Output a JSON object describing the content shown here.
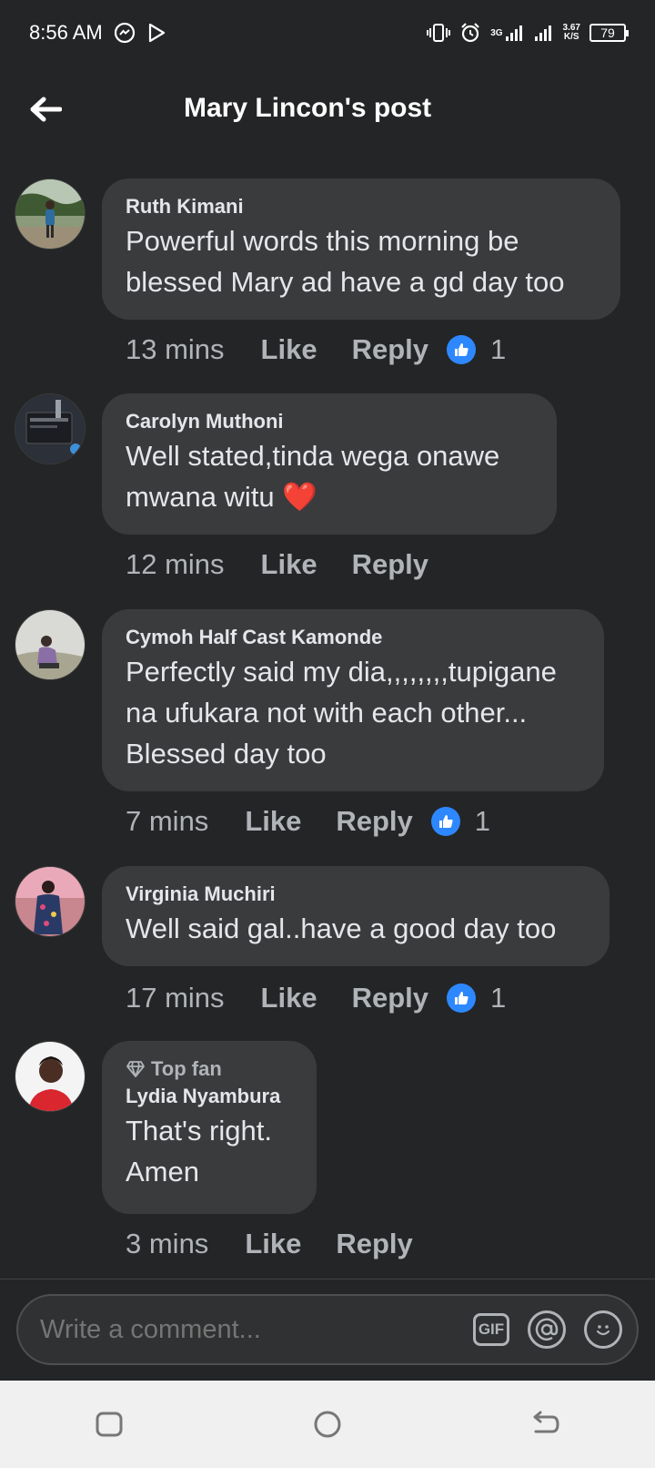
{
  "status_bar": {
    "time": "8:56 AM",
    "network_type": "3G",
    "net_speed_value": "3.67",
    "net_speed_unit": "K/S",
    "battery": "79"
  },
  "header": {
    "title": "Mary Lincon's post"
  },
  "comments": [
    {
      "author": "Ruth Kimani",
      "lines": [
        "Powerful words this morning be",
        "blessed Mary ad have a gd day too"
      ],
      "time": "13 mins",
      "like_label": "Like",
      "reply_label": "Reply",
      "reaction_count": "1"
    },
    {
      "author": "Carolyn Muthoni",
      "lines": [
        "Well stated,tinda wega onawe",
        "mwana witu ❤️"
      ],
      "time": "12 mins",
      "like_label": "Like",
      "reply_label": "Reply"
    },
    {
      "author": "Cymoh Half Cast Kamonde",
      "lines": [
        "Perfectly said my dia,,,,,,,,tupigane",
        "na ufukara not with each other...",
        "Blessed day too"
      ],
      "time": "7 mins",
      "like_label": "Like",
      "reply_label": "Reply",
      "reaction_count": "1"
    },
    {
      "author": "Virginia Muchiri",
      "lines": [
        "Well said gal..have a good day too"
      ],
      "time": "17 mins",
      "like_label": "Like",
      "reply_label": "Reply",
      "reaction_count": "1"
    },
    {
      "badge": "Top fan",
      "author": "Lydia Nyambura",
      "lines": [
        "That's right.",
        "Amen"
      ],
      "time": "3 mins",
      "like_label": "Like",
      "reply_label": "Reply"
    }
  ],
  "composer": {
    "placeholder": "Write a comment...",
    "gif_label": "GIF"
  },
  "colors": {
    "background": "#242526",
    "bubble": "#3a3b3c",
    "like_blue": "#2d88ff"
  }
}
